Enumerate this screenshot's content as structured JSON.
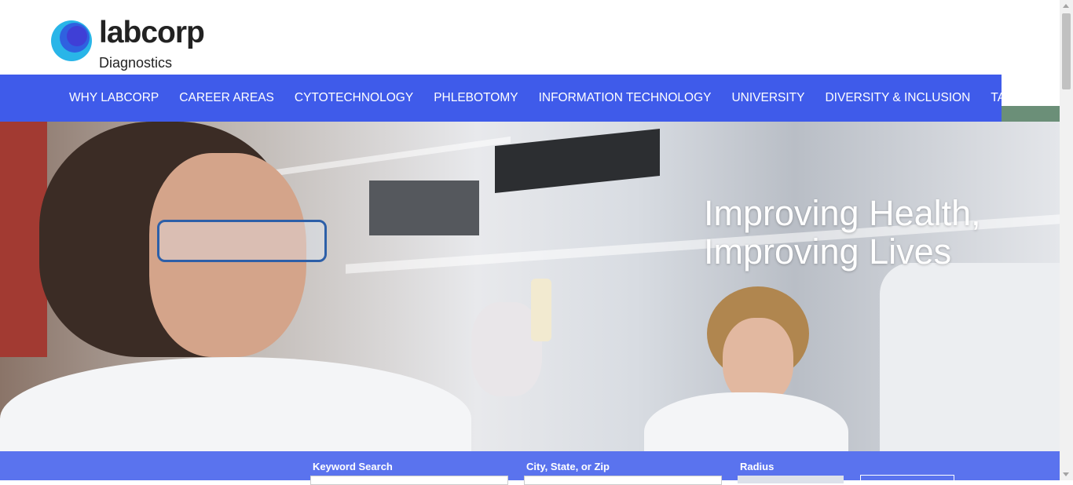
{
  "brand": {
    "name": "labcorp",
    "sub": "Diagnostics",
    "colors": {
      "ring": "#29b5e8",
      "core": "#3f5bea",
      "nav": "#3f5bea"
    }
  },
  "nav": {
    "items": [
      "WHY LABCORP",
      "CAREER AREAS",
      "CYTOTECHNOLOGY",
      "PHLEBOTOMY",
      "INFORMATION TECHNOLOGY",
      "UNIVERSITY",
      "DIVERSITY & INCLUSION",
      "TALENT COMMUNITY"
    ]
  },
  "hero": {
    "line1": "Improving Health,",
    "line2": "Improving Lives"
  },
  "search": {
    "keyword_label": "Keyword Search",
    "location_label": "City, State, or Zip",
    "radius_label": "Radius"
  }
}
